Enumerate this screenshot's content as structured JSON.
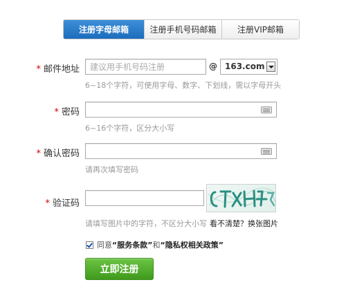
{
  "tabs": [
    {
      "label": "注册字母邮箱",
      "active": true
    },
    {
      "label": "注册手机号码邮箱",
      "active": false
    },
    {
      "label": "注册VIP邮箱",
      "active": false
    }
  ],
  "form": {
    "required_mark": "*",
    "email": {
      "label": "邮件地址",
      "placeholder": "建议用手机号码注册",
      "at": "@",
      "domain": "163.com",
      "hint": "6~18个字符，可使用字母、数字、下划线，需以字母开头"
    },
    "password": {
      "label": "密码",
      "hint": "6~16个字符，区分大小写"
    },
    "confirm_password": {
      "label": "确认密码",
      "hint": "请再次填写密码"
    },
    "captcha": {
      "label": "验证码",
      "hint": "请填写图片中的字符，不区分大小写",
      "change_link": "看不清楚？换张图片"
    },
    "agreement": {
      "prefix": "同意",
      "terms": "“服务条款”",
      "and": "和",
      "privacy": "“隐私权相关政策”",
      "checked": true
    },
    "submit_label": "立即注册"
  },
  "colors": {
    "tab_active": "#1c6cbd",
    "required": "#d40000",
    "submit": "#4ea72a",
    "hint": "#999999"
  }
}
